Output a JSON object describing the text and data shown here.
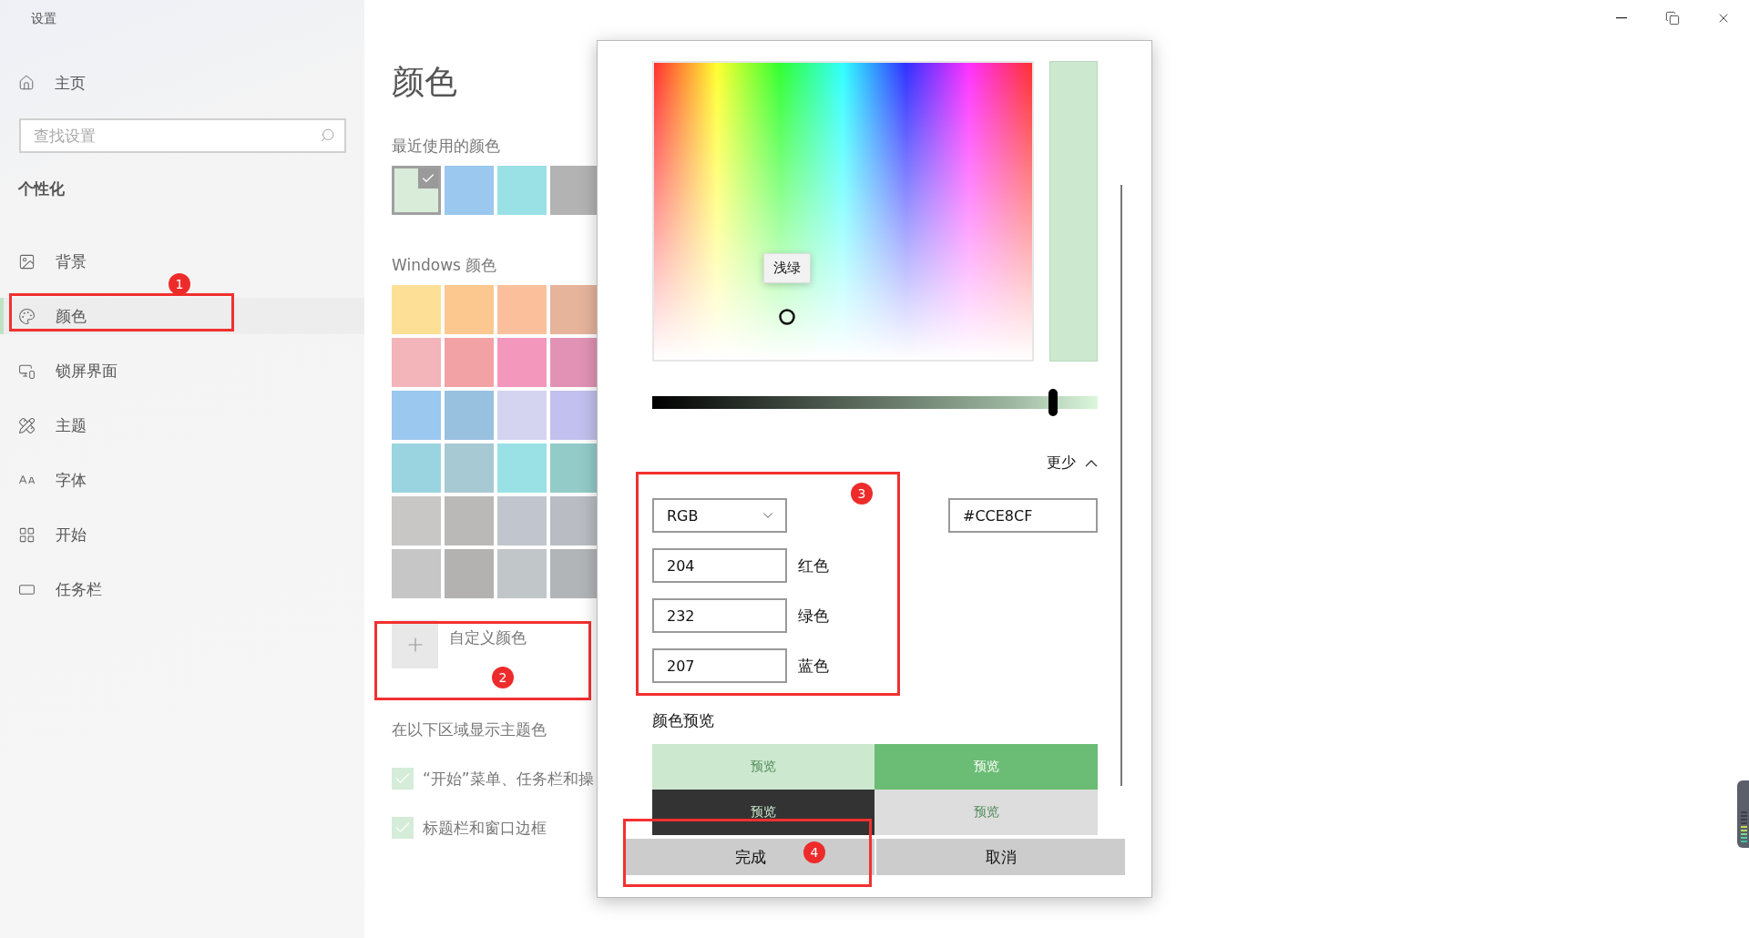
{
  "window": {
    "title": "设置"
  },
  "sidebar": {
    "home": "主页",
    "search": {
      "placeholder": "查找设置"
    },
    "section": "个性化",
    "items": [
      {
        "label": "背景",
        "selected": false
      },
      {
        "label": "颜色",
        "selected": true
      },
      {
        "label": "锁屏界面",
        "selected": false
      },
      {
        "label": "主题",
        "selected": false
      },
      {
        "label": "字体",
        "selected": false
      },
      {
        "label": "开始",
        "selected": false
      },
      {
        "label": "任务栏",
        "selected": false
      }
    ]
  },
  "page": {
    "title": "颜色",
    "recent_label": "最近使用的颜色",
    "recent_colors": [
      {
        "color": "#d9ecd9",
        "selected": true
      },
      {
        "color": "#9ac8ee",
        "selected": false
      },
      {
        "color": "#9ae1e6",
        "selected": false
      },
      {
        "color": "#b3b3b3",
        "selected": false
      }
    ],
    "windows_label": "Windows 颜色",
    "windows_colors": [
      {
        "color": "#fde095"
      },
      {
        "color": "#fdc88f"
      },
      {
        "color": "#fbbf9b"
      },
      {
        "color": "#e6b49b"
      },
      {
        "color": "#f3b4ba"
      },
      {
        "color": "#f2a1a5"
      },
      {
        "color": "#f497bd"
      },
      {
        "color": "#e293b5"
      },
      {
        "color": "#9ac8ee"
      },
      {
        "color": "#98c1e0"
      },
      {
        "color": "#d4d3f0"
      },
      {
        "color": "#c2c0ee"
      },
      {
        "color": "#9ad4e0"
      },
      {
        "color": "#a7c9d3"
      },
      {
        "color": "#9ae1e6"
      },
      {
        "color": "#93cbc8"
      },
      {
        "color": "#c8c7c6"
      },
      {
        "color": "#bab9b7"
      },
      {
        "color": "#c1c5cd"
      },
      {
        "color": "#b9bdc3"
      },
      {
        "color": "#c6c6c6"
      },
      {
        "color": "#b3b2b1"
      },
      {
        "color": "#c1c6c9"
      },
      {
        "color": "#b2b5b8"
      }
    ],
    "custom_color": "自定义颜色",
    "accent_label": "在以下区域显示主题色",
    "accent_options": [
      {
        "label": "“开始”菜单、任务栏和操",
        "checked": true
      },
      {
        "label": "标题栏和窗口边框",
        "checked": true
      }
    ]
  },
  "dialog": {
    "tooltip": "浅绿",
    "brightness": {
      "level": 0.9
    },
    "toggle": "更少",
    "mode": "RGB",
    "hex": "#CCE8CF",
    "channels": [
      {
        "value": "204",
        "label": "红色"
      },
      {
        "value": "232",
        "label": "绿色"
      },
      {
        "value": "207",
        "label": "蓝色"
      }
    ],
    "preview_label": "颜色预览",
    "previews": [
      {
        "label": "预览",
        "color": "#cce8cf"
      },
      {
        "label": "预览",
        "color": "#6bbc74"
      },
      {
        "label": "预览",
        "color": "#333333"
      },
      {
        "label": "预览",
        "color": "#dddddd"
      }
    ],
    "buttons": [
      "完成",
      "取消"
    ]
  },
  "annotations": [
    {
      "number": "1"
    },
    {
      "number": "2"
    },
    {
      "number": "3"
    },
    {
      "number": "4"
    }
  ]
}
